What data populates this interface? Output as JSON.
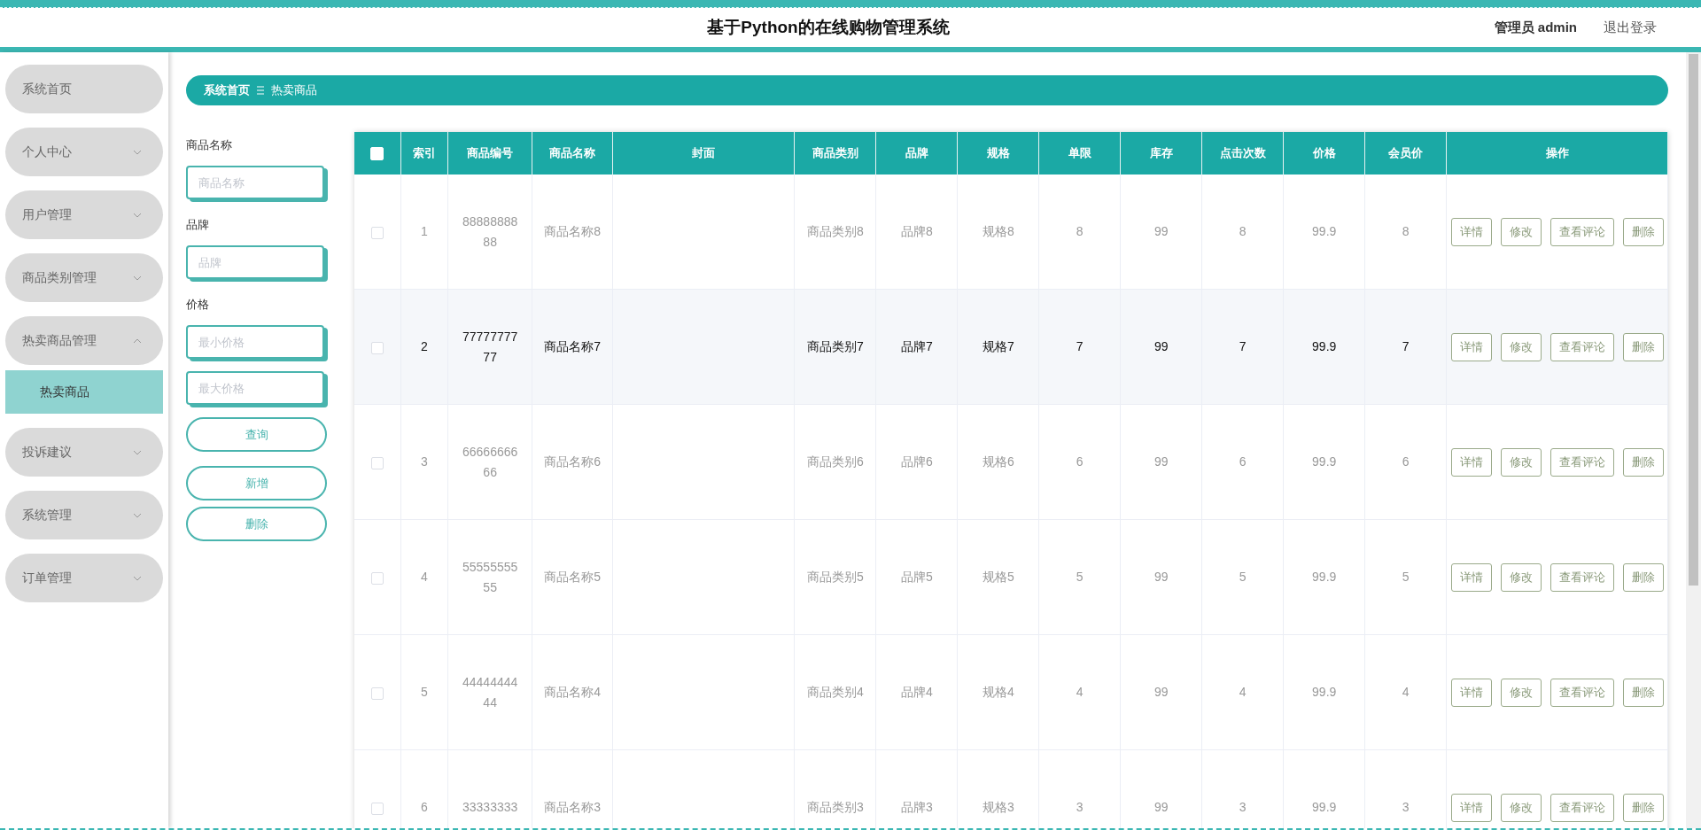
{
  "header": {
    "title": "基于Python的在线购物管理系统",
    "user": "管理员 admin",
    "logout": "退出登录"
  },
  "sidebar": {
    "items": [
      {
        "label": "系统首页",
        "kind": "link"
      },
      {
        "label": "个人中心",
        "kind": "menu",
        "expanded": false
      },
      {
        "label": "用户管理",
        "kind": "menu",
        "expanded": false
      },
      {
        "label": "商品类别管理",
        "kind": "menu",
        "expanded": false
      },
      {
        "label": "热卖商品管理",
        "kind": "menu",
        "expanded": true,
        "children": [
          {
            "label": "热卖商品",
            "selected": true
          }
        ]
      },
      {
        "label": "投诉建议",
        "kind": "menu",
        "expanded": false
      },
      {
        "label": "系统管理",
        "kind": "menu",
        "expanded": false
      },
      {
        "label": "订单管理",
        "kind": "menu",
        "expanded": false
      }
    ]
  },
  "breadcrumb": [
    "系统首页",
    "热卖商品"
  ],
  "filters": [
    {
      "label": "商品名称",
      "inputs": [
        {
          "placeholder": "商品名称"
        }
      ]
    },
    {
      "label": "品牌",
      "inputs": [
        {
          "placeholder": "品牌"
        }
      ]
    },
    {
      "label": "价格",
      "inputs": [
        {
          "placeholder": "最小价格"
        },
        {
          "placeholder": "最大价格"
        }
      ]
    }
  ],
  "filter_buttons": [
    "查询",
    "新增",
    "删除"
  ],
  "table": {
    "select_all": {
      "checked": false
    },
    "columns": [
      "索引",
      "商品编号",
      "商品名称",
      "封面",
      "商品类别",
      "品牌",
      "规格",
      "单限",
      "库存",
      "点击次数",
      "价格",
      "会员价",
      "操作"
    ],
    "rows": [
      {
        "checked": false,
        "highlighted": false,
        "cells": [
          "1",
          "8888888888",
          "商品名称8",
          "",
          "商品类别8",
          "品牌8",
          "规格8",
          "8",
          "99",
          "8",
          "99.9",
          "8"
        ],
        "actions": [
          "详情",
          "修改",
          "查看评论",
          "删除"
        ]
      },
      {
        "checked": false,
        "highlighted": true,
        "cells": [
          "2",
          "7777777777",
          "商品名称7",
          "",
          "商品类别7",
          "品牌7",
          "规格7",
          "7",
          "99",
          "7",
          "99.9",
          "7"
        ],
        "actions": [
          "详情",
          "修改",
          "查看评论",
          "删除"
        ]
      },
      {
        "checked": false,
        "highlighted": false,
        "cells": [
          "3",
          "6666666666",
          "商品名称6",
          "",
          "商品类别6",
          "品牌6",
          "规格6",
          "6",
          "99",
          "6",
          "99.9",
          "6"
        ],
        "actions": [
          "详情",
          "修改",
          "查看评论",
          "删除"
        ]
      },
      {
        "checked": false,
        "highlighted": false,
        "cells": [
          "4",
          "5555555555",
          "商品名称5",
          "",
          "商品类别5",
          "品牌5",
          "规格5",
          "5",
          "99",
          "5",
          "99.9",
          "5"
        ],
        "actions": [
          "详情",
          "修改",
          "查看评论",
          "删除"
        ]
      },
      {
        "checked": false,
        "highlighted": false,
        "cells": [
          "5",
          "4444444444",
          "商品名称4",
          "",
          "商品类别4",
          "品牌4",
          "规格4",
          "4",
          "99",
          "4",
          "99.9",
          "4"
        ],
        "actions": [
          "详情",
          "修改",
          "查看评论",
          "删除"
        ]
      },
      {
        "checked": false,
        "highlighted": false,
        "cells": [
          "6",
          "33333333",
          "商品名称3",
          "",
          "商品类别3",
          "品牌3",
          "规格3",
          "3",
          "99",
          "3",
          "99.9",
          "3"
        ],
        "actions": [
          "详情",
          "修改",
          "查看评论",
          "删除"
        ]
      }
    ]
  }
}
